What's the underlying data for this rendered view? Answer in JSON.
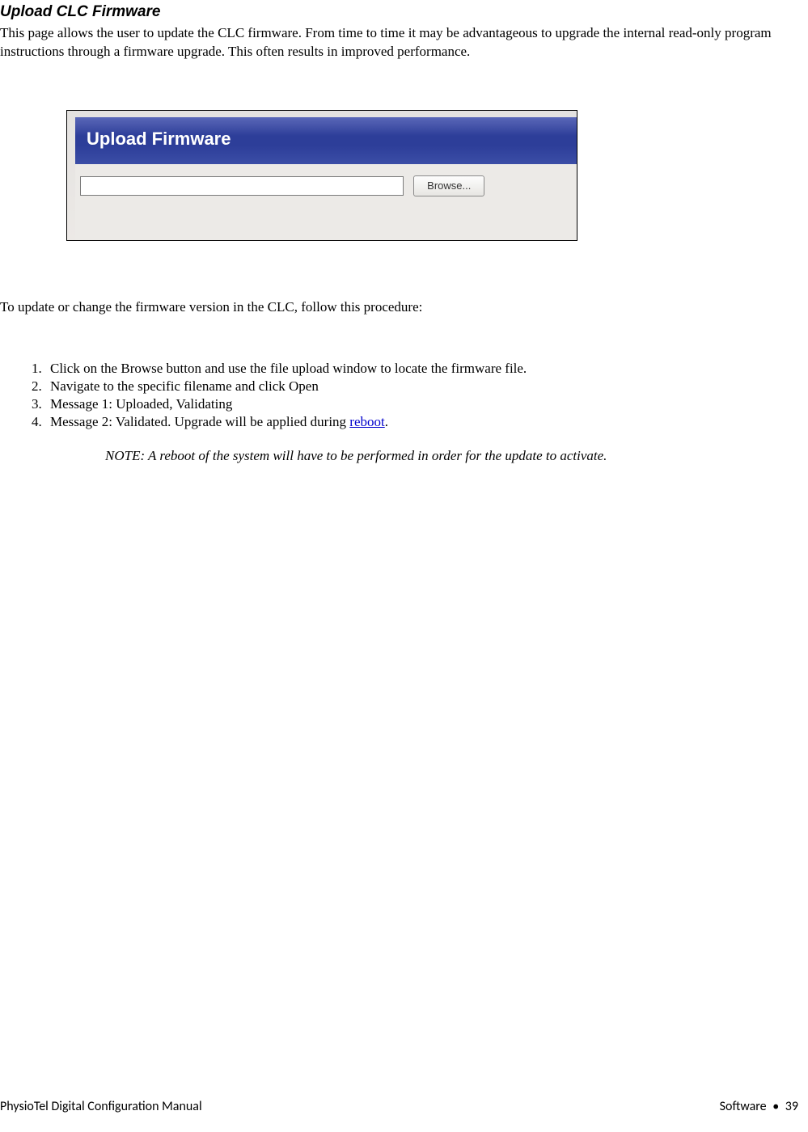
{
  "heading": "Upload CLC Firmware",
  "intro": "This page allows the user to update the CLC firmware. From time to time it may be advantageous to upgrade the internal read-only program instructions through a firmware upgrade. This often results in improved performance.",
  "screenshot": {
    "title": "Upload Firmware",
    "file_value": "",
    "browse_label": "Browse..."
  },
  "procedure_intro": "To update or change the firmware version in the CLC, follow this procedure:",
  "steps": {
    "s1": "Click on the Browse button and use the file upload window to locate the firmware file.",
    "s2": "Navigate to the specific filename and click Open",
    "s3": "Message 1: Uploaded, Validating",
    "s4_pre": "Message 2: Validated. Upgrade will be applied during ",
    "s4_link": "reboot",
    "s4_post": "."
  },
  "note": "NOTE: A reboot of the system will have to be performed in order for the update to activate.",
  "footer": {
    "left": "PhysioTel Digital Configuration Manual",
    "right_section": "Software",
    "right_bullet": "•",
    "right_page": "39"
  }
}
